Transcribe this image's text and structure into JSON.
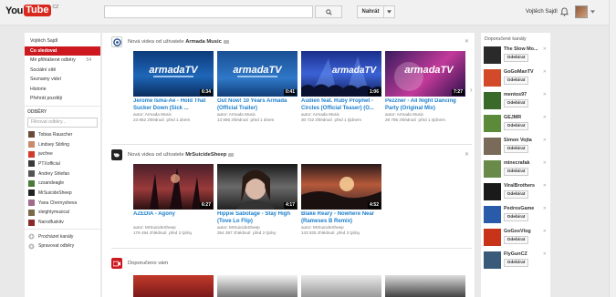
{
  "header": {
    "logo_you": "You",
    "logo_tube": "Tube",
    "logo_region": "CZ",
    "search_placeholder": "",
    "upload_label": "Nahrát",
    "user_name": "Vojtěch Sajdl"
  },
  "sidebar": {
    "nav": [
      {
        "label": "Vojtěch Sajdl",
        "count": ""
      },
      {
        "label": "Co sledovat",
        "count": ""
      },
      {
        "label": "Mé přihlášené odběry",
        "count": "54"
      },
      {
        "label": "Sociální sítě",
        "count": ""
      },
      {
        "label": "Seznamy videí",
        "count": ""
      },
      {
        "label": "Historie",
        "count": ""
      },
      {
        "label": "Přehrát později",
        "count": ""
      }
    ],
    "subs_title": "ODBĚRY",
    "filter_placeholder": "Filtrovat odběry...",
    "subscriptions": [
      {
        "name": "Tobias Rauscher",
        "color": "#6b4a3a"
      },
      {
        "name": "Lindsey Stirling",
        "color": "#c98a6a"
      },
      {
        "name": "jwcfree",
        "color": "#d23a2a"
      },
      {
        "name": "PTXofficial",
        "color": "#3a3a3a"
      },
      {
        "name": "Andrey Shlefan",
        "color": "#555555"
      },
      {
        "name": "czsandeagle",
        "color": "#4a7a3a"
      },
      {
        "name": "MrSuicideSheep",
        "color": "#222222"
      },
      {
        "name": "Yana Chernysheva",
        "color": "#a06a8a"
      },
      {
        "name": "xleightymusical",
        "color": "#7a6a4a"
      },
      {
        "name": "Narodfuskitv",
        "color": "#8a2a2a"
      }
    ],
    "footer": [
      {
        "label": "Procházet kanály"
      },
      {
        "label": "Spravovat odběry"
      }
    ]
  },
  "main": {
    "sections": [
      {
        "prefix": "Nová videa od uživatele",
        "channel": "Armada Music",
        "videos": [
          {
            "title": "Jerome Isma-Ae - Hold That Sucker Down (Sick ...",
            "duration": "6:34",
            "author": "autor: Armada Music",
            "views": "23 862 zhlédnutí",
            "age": "před 1 dnem"
          },
          {
            "title": "Out Now! 10 Years Armada (Official Trailer)",
            "duration": "0:41",
            "author": "autor: Armada Music",
            "views": "13 866 zhlédnutí",
            "age": "před 1 dnem"
          },
          {
            "title": "Audien feat. Ruby Prophet - Circles (Official Teaser) (O...",
            "duration": "1:06",
            "author": "autor: Armada Music",
            "views": "30 722 zhlédnutí",
            "age": "před 1 týdnem"
          },
          {
            "title": "Pezzner - All Night Dancing Party (Original Mix)",
            "duration": "7:27",
            "author": "autor: Armada Music",
            "views": "28 785 zhlédnutí",
            "age": "před 1 týdnem"
          }
        ]
      },
      {
        "prefix": "Nová videa od uživatele",
        "channel": "MrSuicideSheep",
        "videos": [
          {
            "title": "AZEDIA - Agony",
            "duration": "6:27",
            "author": "autor: MrSuicideSheep",
            "views": "176 494 zhlédnutí",
            "age": "před 2 týdny"
          },
          {
            "title": "Hippie Sabotage - Stay High (Tove Lo Flip)",
            "duration": "4:17",
            "author": "autor: MrSuicideSheep",
            "views": "354 357 zhlédnutí",
            "age": "před 2 týdny"
          },
          {
            "title": "Blake Reary - Nowhere Near (Rameses B Remix)",
            "duration": "4:52",
            "author": "autor: MrSuicideSheep",
            "views": "143 825 zhlédnutí",
            "age": "před 2 týdny"
          }
        ]
      }
    ],
    "recommended_title": "Doporučeno vám"
  },
  "rightbar": {
    "title": "Doporučené kanály",
    "button_label": "Odebírat",
    "channels": [
      {
        "name": "The Slow Mo...",
        "color": "#2a2a2a"
      },
      {
        "name": "GoGoManTV",
        "color": "#d24a2a"
      },
      {
        "name": "mentos97",
        "color": "#3a6a2a"
      },
      {
        "name": "GEJMR",
        "color": "#5a8a3a"
      },
      {
        "name": "Simon Vojta",
        "color": "#7a6a5a"
      },
      {
        "name": "minecrafak",
        "color": "#6a8a4a"
      },
      {
        "name": "ViralBrothers",
        "color": "#1a1a1a"
      },
      {
        "name": "PedrosGame",
        "color": "#2a5aaa"
      },
      {
        "name": "GoGosVlog",
        "color": "#c8341a"
      },
      {
        "name": "FlyGunCZ",
        "color": "#3a5a7a"
      }
    ]
  }
}
